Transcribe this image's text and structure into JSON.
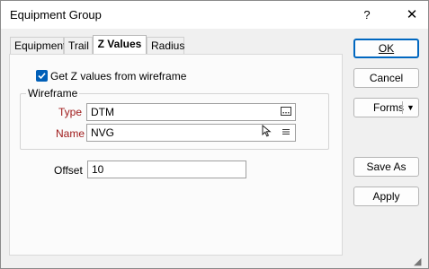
{
  "window": {
    "title": "Equipment Group",
    "help": "?",
    "close": "✕"
  },
  "tabs": [
    {
      "label": "Equipment",
      "active": false
    },
    {
      "label": "Trail",
      "active": false
    },
    {
      "label": "Z Values",
      "active": true
    },
    {
      "label": "Radius",
      "active": false
    }
  ],
  "zvalues": {
    "get_from_wireframe": {
      "label": "Get Z values from wireframe",
      "checked": true
    },
    "wireframe_group": {
      "title": "Wireframe",
      "type": {
        "label": "Type",
        "value": "DTM",
        "icon": "ellipsis-icon"
      },
      "name": {
        "label": "Name",
        "value": "NVG",
        "icons": [
          "cursor-pick-icon",
          "list-icon"
        ]
      }
    },
    "offset": {
      "label": "Offset",
      "value": "10"
    }
  },
  "buttons": {
    "ok": "OK",
    "cancel": "Cancel",
    "forms": "Forms",
    "save_as": "Save As",
    "apply": "Apply"
  },
  "colors": {
    "accent": "#005fb8",
    "required_label": "#a01c1c"
  }
}
